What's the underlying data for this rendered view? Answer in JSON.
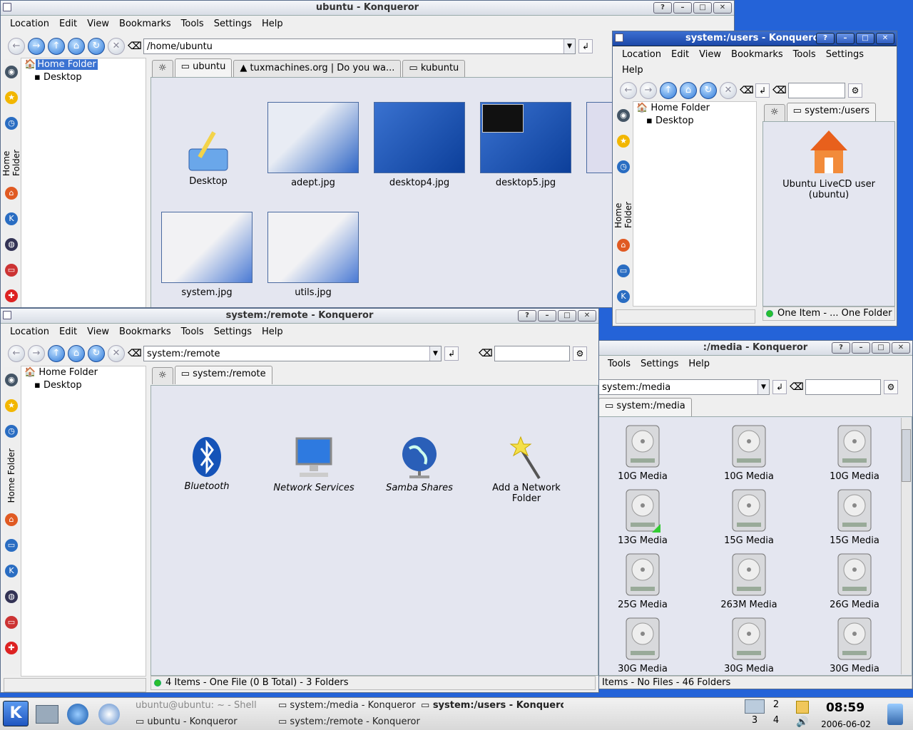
{
  "colors": {
    "desktop": "#2463d8",
    "titlebar_active": "#1c48a8",
    "pane_bg": "#e4e6f0",
    "accent": "#3b73d2"
  },
  "win_ubuntu": {
    "title": "ubuntu - Konqueror",
    "menu": [
      "Location",
      "Edit",
      "View",
      "Bookmarks",
      "Tools",
      "Settings",
      "Help"
    ],
    "url": "/home/ubuntu",
    "tree": [
      "Home Folder",
      "Desktop"
    ],
    "side_label": "Home Folder",
    "tabs": [
      "ubuntu",
      "tuxmachines.org | Do you wa...",
      "kubuntu"
    ],
    "items": [
      "Desktop",
      "adept.jpg",
      "desktop4.jpg",
      "desktop5.jpg",
      "system.jpg",
      "utils.jpg"
    ]
  },
  "win_users": {
    "title": "system:/users - Konqueror",
    "menu": [
      "Location",
      "Edit",
      "View",
      "Bookmarks",
      "Tools",
      "Settings",
      "Help"
    ],
    "tree": [
      "Home Folder",
      "Desktop"
    ],
    "side_label": "Home Folder",
    "tab": "system:/users",
    "item": "Ubuntu LiveCD user (ubuntu)",
    "status": "One Item - ... One Folder"
  },
  "win_remote": {
    "title": "system:/remote - Konqueror",
    "menu": [
      "Location",
      "Edit",
      "View",
      "Bookmarks",
      "Tools",
      "Settings",
      "Help"
    ],
    "url": "system:/remote",
    "tree": [
      "Home Folder",
      "Desktop"
    ],
    "side_label": "Home Folder",
    "tab": "system:/remote",
    "items": [
      "Bluetooth",
      "Network Services",
      "Samba Shares",
      "Add a Network Folder"
    ],
    "status": "4 Items - One File (0 B Total) - 3 Folders"
  },
  "win_media": {
    "title": ":/media - Konqueror",
    "menu": [
      "Tools",
      "Settings",
      "Help"
    ],
    "url": "system:/media",
    "tab": "system:/media",
    "items": [
      "10G Media",
      "10G Media",
      "10G Media",
      "13G Media",
      "15G Media",
      "15G Media",
      "25G Media",
      "263M Media",
      "26G Media",
      "30G Media",
      "30G Media",
      "30G Media"
    ],
    "status": "Items - No Files - 46 Folders"
  },
  "taskbar": {
    "tasks": [
      "ubuntu@ubuntu: ~ - Shell",
      "system:/media - Konqueror",
      "system:/users - Konqueror",
      "ubuntu - Konqueror",
      "system:/remote - Konqueror"
    ],
    "desktops": [
      "2",
      "3",
      "4"
    ],
    "time": "08:59",
    "date": "2006-06-02"
  }
}
